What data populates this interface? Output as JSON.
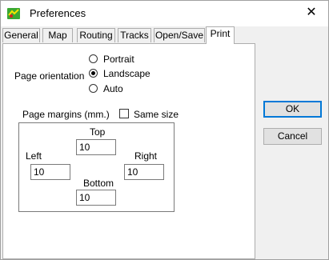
{
  "window": {
    "title": "Preferences",
    "close_glyph": "✕"
  },
  "tabs": [
    {
      "label": "General"
    },
    {
      "label": "Map"
    },
    {
      "label": "Routing"
    },
    {
      "label": "Tracks"
    },
    {
      "label": "Open/Save"
    },
    {
      "label": "Print",
      "active": true
    }
  ],
  "print": {
    "orientation_label": "Page orientation",
    "orientation_options": [
      {
        "label": "Portrait",
        "selected": false
      },
      {
        "label": "Landscape",
        "selected": true
      },
      {
        "label": "Auto",
        "selected": false
      }
    ],
    "margins_label": "Page margins (mm.)",
    "same_size_label": "Same size",
    "same_size_checked": false,
    "margins": {
      "top_label": "Top",
      "top_value": "10",
      "left_label": "Left",
      "left_value": "10",
      "right_label": "Right",
      "right_value": "10",
      "bottom_label": "Bottom",
      "bottom_value": "10"
    }
  },
  "buttons": {
    "ok": "OK",
    "cancel": "Cancel"
  },
  "colors": {
    "accent": "#0078d7",
    "icon_green": "#3aa832"
  }
}
